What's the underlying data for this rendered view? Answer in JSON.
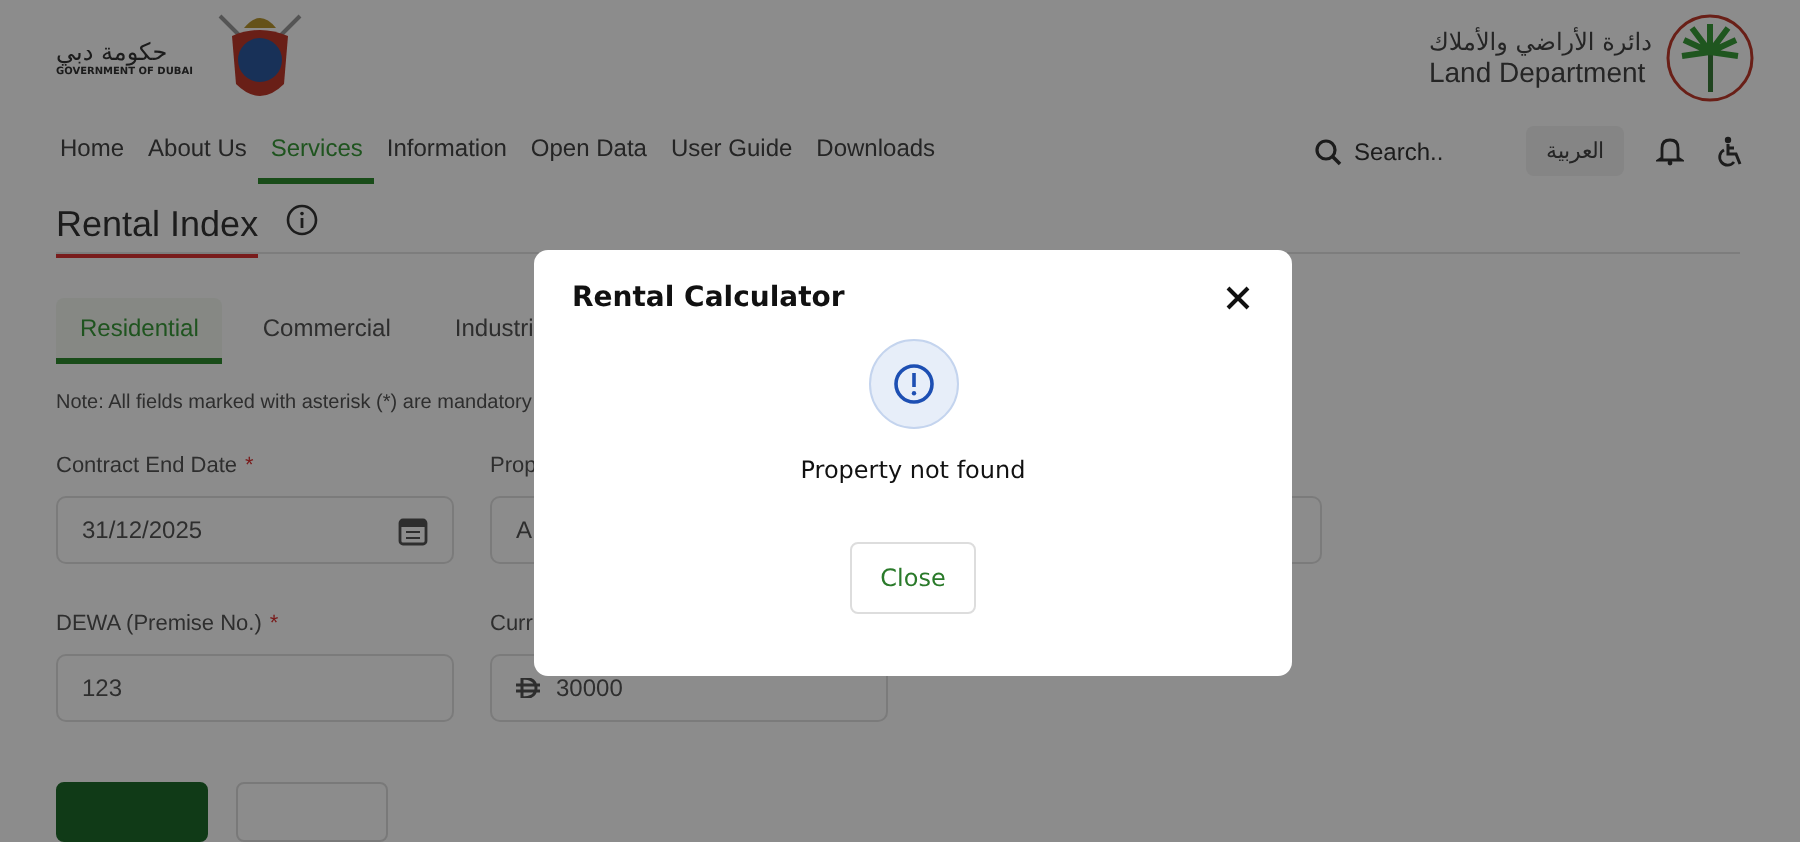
{
  "header": {
    "government_logo": {
      "arabic": "حكومة دبي",
      "english": "GOVERNMENT OF DUBAI"
    },
    "department_logo": {
      "arabic": "دائرة الأراضي والأملاك",
      "english": "Land Department"
    }
  },
  "nav": {
    "items": [
      {
        "label": "Home",
        "selected": false
      },
      {
        "label": "About Us",
        "selected": false
      },
      {
        "label": "Services",
        "selected": true
      },
      {
        "label": "Information",
        "selected": false
      },
      {
        "label": "Open Data",
        "selected": false
      },
      {
        "label": "User Guide",
        "selected": false
      },
      {
        "label": "Downloads",
        "selected": false
      }
    ],
    "search": {
      "placeholder": "Search.."
    },
    "language_button": "العربية"
  },
  "page": {
    "title": "Rental Index",
    "tabs": [
      {
        "label": "Residential",
        "selected": true
      },
      {
        "label": "Commercial",
        "selected": false
      },
      {
        "label": "Industri",
        "selected": false
      }
    ],
    "note": "Note: All fields marked with asterisk (*) are mandatory",
    "fields": [
      {
        "kind": "date",
        "label": "Contract End Date",
        "required_mark": "*",
        "value": "31/12/2025"
      },
      {
        "kind": "text",
        "label": "Prop",
        "value": "A"
      },
      {
        "kind": "text"
      },
      {
        "kind": "text",
        "label": "DEWA (Premise No.)",
        "required_mark": "*",
        "value": "123"
      },
      {
        "kind": "currency",
        "label": "Curr",
        "value": "30000"
      }
    ],
    "actions": [
      {
        "kind": "primary"
      },
      {
        "kind": "secondary"
      }
    ]
  },
  "modal": {
    "title": "Rental Calculator",
    "message": "Property not found",
    "button": "Close"
  }
}
